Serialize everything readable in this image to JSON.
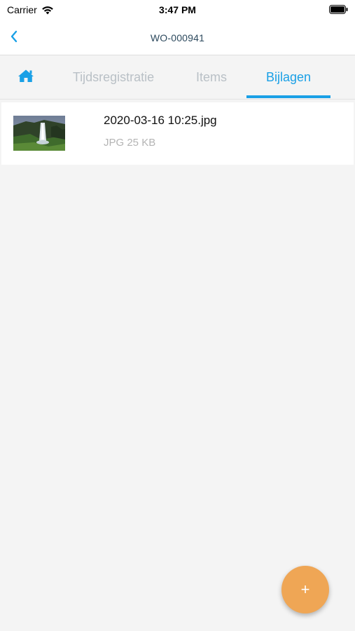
{
  "status_bar": {
    "carrier": "Carrier",
    "time": "3:47 PM",
    "icons": [
      "wifi-icon",
      "battery-icon"
    ]
  },
  "nav": {
    "back_icon": "chevron-left-icon",
    "title": "WO-000941"
  },
  "tabs": [
    {
      "icon": "home-icon",
      "label": "",
      "active": false
    },
    {
      "label": "Tijdsregistratie",
      "active": false
    },
    {
      "label": "Items",
      "active": false
    },
    {
      "label": "Bijlagen",
      "active": true
    }
  ],
  "attachments": [
    {
      "thumbnail": "waterfall-photo-thumbnail",
      "name": "2020-03-16 10:25.jpg",
      "meta": "JPG 25 KB"
    }
  ],
  "fab": {
    "label": "+",
    "icon": "plus-icon"
  },
  "colors": {
    "accent": "#1aa0e6",
    "inactive_tab": "#b9c0c6",
    "fab": "#efa655",
    "background": "#f4f4f4",
    "title": "#2d4a5e"
  }
}
